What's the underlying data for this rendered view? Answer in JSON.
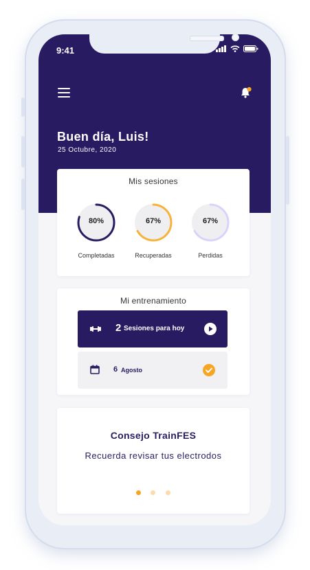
{
  "status_bar": {
    "time": "9:41"
  },
  "header": {
    "greeting": "Buen día, Luis!",
    "date": "25 Octubre, 2020",
    "notification_dot_color": "#f5a623"
  },
  "sessions": {
    "title": "Mis sesiones",
    "rings": [
      {
        "value_label": "80%",
        "value": 0.8,
        "label": "Completadas",
        "color": "#291b62"
      },
      {
        "value_label": "67%",
        "value": 0.67,
        "label": "Recuperadas",
        "color": "#f7b23b"
      },
      {
        "value_label": "67%",
        "value": 0.67,
        "label": "Perdidas",
        "color": "#d8d3fb"
      }
    ]
  },
  "training": {
    "title": "Mi entrenamiento",
    "today_count": "2",
    "today_label": "Sesiones para hoy",
    "next_day": "6",
    "next_month": "Agosto"
  },
  "tip": {
    "title": "Consejo TrainFES",
    "text": "Recuerda revisar tus electrodos",
    "pager": {
      "count": 3,
      "active": 0
    }
  },
  "colors": {
    "brand": "#291b62",
    "accent": "#f5a623",
    "background": "#f6f6f9"
  }
}
